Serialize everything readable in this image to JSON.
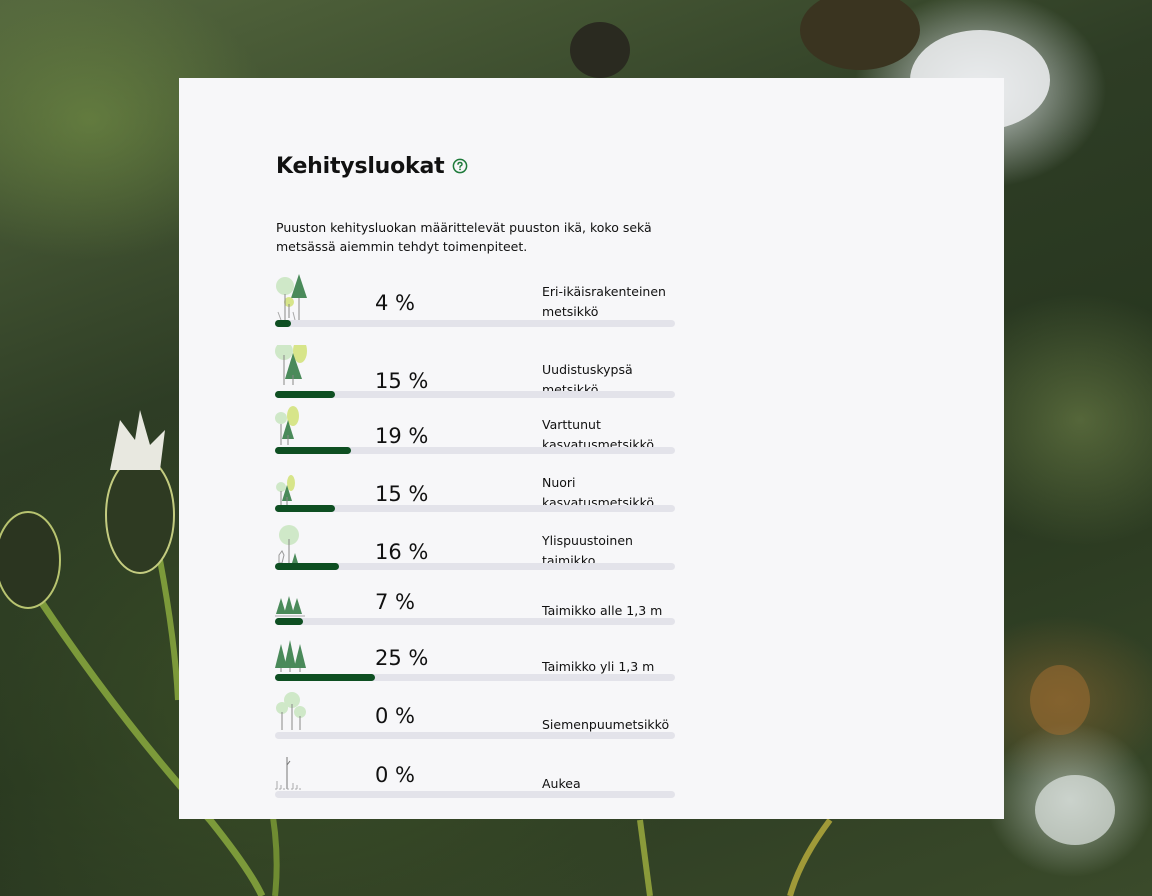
{
  "section": {
    "title": "Kehitysluokat",
    "help_icon": "help-circle-icon",
    "description": "Puuston kehitysluokan määrittelevät puuston ikä, koko sekä metsässä aiemmin tehdyt toimenpiteet."
  },
  "colors": {
    "bar_fill": "#0e4f22",
    "bar_track": "#e3e3ea",
    "help_icon": "#1e7a3a"
  },
  "classes": [
    {
      "label": "Eri-ikäisrakenteinen metsikkö",
      "percent_text": "4 %",
      "value": 4,
      "icon": "mixed-age-forest-icon"
    },
    {
      "label": "Uudistuskypsä metsikkö",
      "percent_text": "15 %",
      "value": 15,
      "icon": "mature-forest-icon"
    },
    {
      "label": "Varttunut kasvatusmetsikkö",
      "percent_text": "19 %",
      "value": 19,
      "icon": "advanced-thinning-forest-icon"
    },
    {
      "label": "Nuori kasvatusmetsikkö",
      "percent_text": "15 %",
      "value": 15,
      "icon": "young-thinning-forest-icon"
    },
    {
      "label": "Ylispuustoinen taimikko",
      "percent_text": "16 %",
      "value": 16,
      "icon": "seedling-stand-with-overstory-icon"
    },
    {
      "label": "Taimikko alle 1,3 m",
      "percent_text": "7 %",
      "value": 7,
      "icon": "small-seedlings-icon"
    },
    {
      "label": "Taimikko yli 1,3 m",
      "percent_text": "25 %",
      "value": 25,
      "icon": "large-seedlings-icon"
    },
    {
      "label": "Siemenpuumetsikkö",
      "percent_text": "0 %",
      "value": 0,
      "icon": "seed-tree-stand-icon"
    },
    {
      "label": "Aukea",
      "percent_text": "0 %",
      "value": 0,
      "icon": "open-area-icon"
    }
  ]
}
